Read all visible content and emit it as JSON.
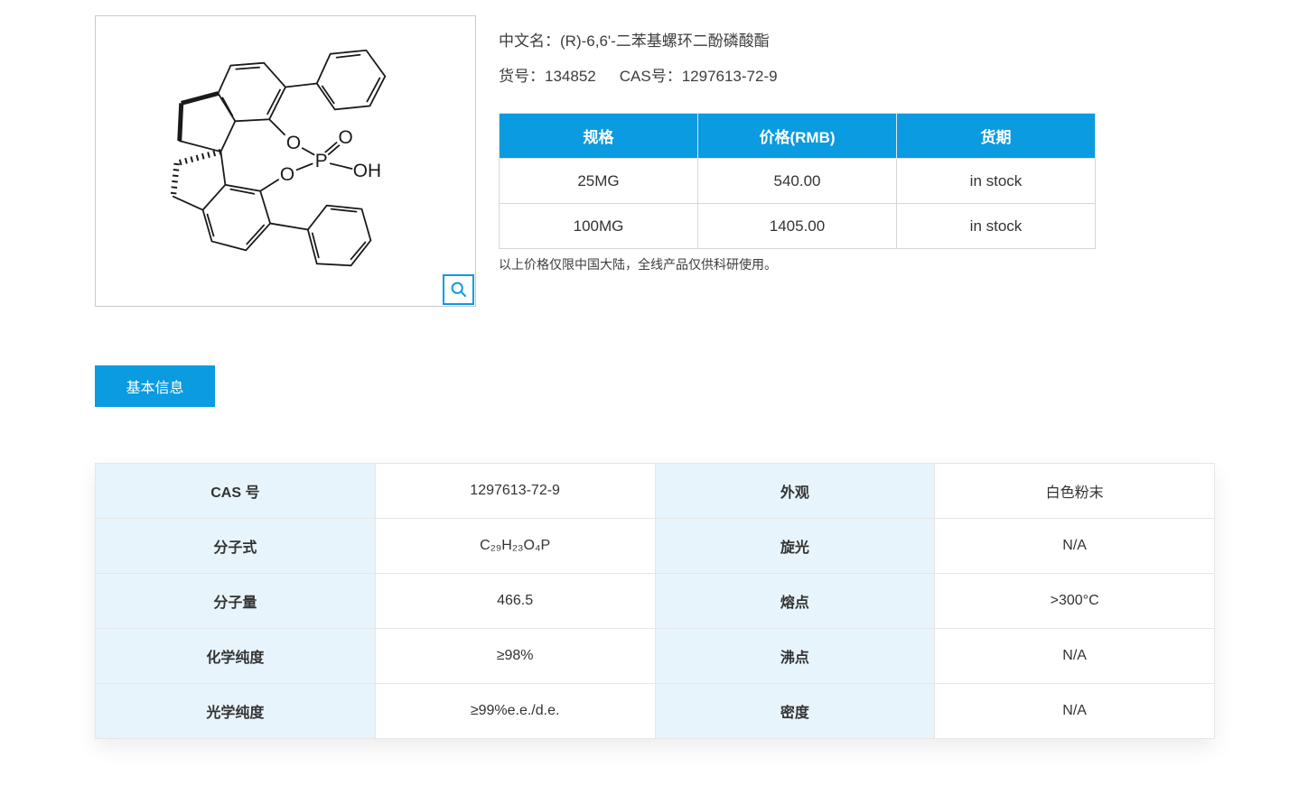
{
  "colors": {
    "primary": "#0a9be0",
    "label_cell": "#e8f4fb"
  },
  "product": {
    "cn_name_label": "中文名：",
    "cn_name": "(R)-6,6'-二苯基螺环二酚磷酸酯",
    "catalog_label": "货号：",
    "catalog_no": "134852",
    "cas_label": "CAS号：",
    "cas_no": "1297613-72-9"
  },
  "structure_atoms": {
    "o_top": "O",
    "p": "P",
    "o_double": "O",
    "oh": "OH",
    "o_bottom": "O"
  },
  "price_table": {
    "headers": [
      "规格",
      "价格(RMB)",
      "货期"
    ],
    "rows": [
      [
        "25MG",
        "540.00",
        "in stock"
      ],
      [
        "100MG",
        "1405.00",
        "in stock"
      ]
    ],
    "note": "以上价格仅限中国大陆，全线产品仅供科研使用。"
  },
  "tabs": {
    "basic_info": "基本信息"
  },
  "basic_info_table": {
    "rows": [
      {
        "label1": "CAS 号",
        "value1": "1297613-72-9",
        "label2": "外观",
        "value2": "白色粉末"
      },
      {
        "label1": "分子式",
        "value1": "C₂₉H₂₃O₄P",
        "label2": "旋光",
        "value2": "N/A"
      },
      {
        "label1": "分子量",
        "value1": "466.5",
        "label2": "熔点",
        "value2": ">300°C"
      },
      {
        "label1": "化学纯度",
        "value1": "≥98%",
        "label2": "沸点",
        "value2": "N/A"
      },
      {
        "label1": "光学纯度",
        "value1": "≥99%e.e./d.e.",
        "label2": "密度",
        "value2": "N/A"
      }
    ]
  }
}
